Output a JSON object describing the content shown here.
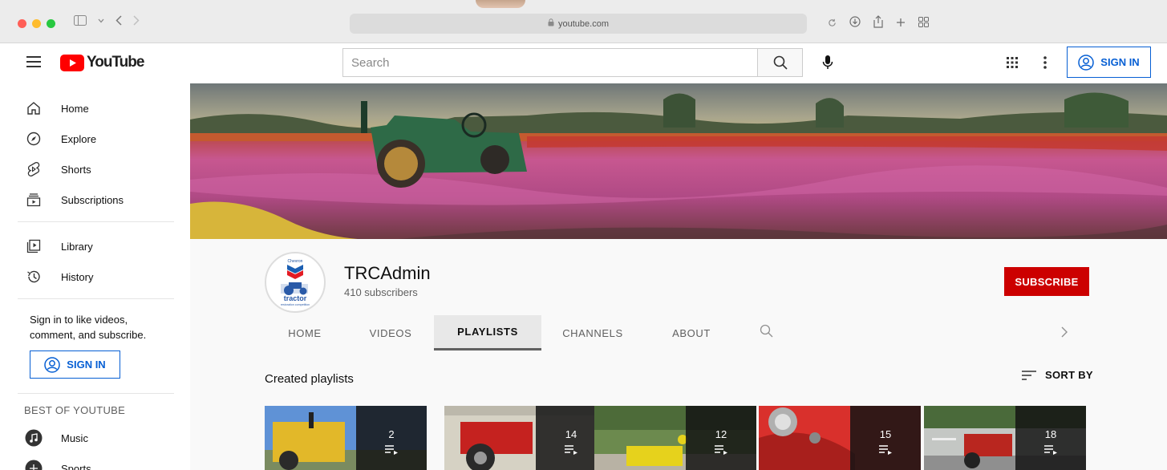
{
  "browser": {
    "url": "youtube.com"
  },
  "masthead": {
    "logo_text": "YouTube",
    "search_placeholder": "Search",
    "sign_in_label": "SIGN IN"
  },
  "sidebar": {
    "items": [
      {
        "label": "Home",
        "icon": "home-icon"
      },
      {
        "label": "Explore",
        "icon": "compass-icon"
      },
      {
        "label": "Shorts",
        "icon": "shorts-icon"
      },
      {
        "label": "Subscriptions",
        "icon": "subscriptions-icon"
      },
      {
        "label": "Library",
        "icon": "library-icon"
      },
      {
        "label": "History",
        "icon": "history-icon"
      }
    ],
    "signin_prompt": "Sign in to like videos, comment, and subscribe.",
    "sign_in_label": "SIGN IN",
    "best_title": "BEST OF YOUTUBE",
    "best_items": [
      {
        "label": "Music",
        "icon": "music-icon"
      },
      {
        "label": "Sports",
        "icon": "sports-icon"
      }
    ]
  },
  "channel": {
    "name": "TRCAdmin",
    "subscribers": "410 subscribers",
    "subscribe_label": "SUBSCRIBE",
    "avatar_text_top": "Chevron",
    "avatar_text": "tractor",
    "avatar_text_sub": "restoration competition",
    "tabs": [
      {
        "label": "HOME",
        "active": false
      },
      {
        "label": "VIDEOS",
        "active": false
      },
      {
        "label": "PLAYLISTS",
        "active": true
      },
      {
        "label": "CHANNELS",
        "active": false
      },
      {
        "label": "ABOUT",
        "active": false
      }
    ]
  },
  "playlists": {
    "section_title": "Created playlists",
    "sort_label": "SORT BY",
    "items": [
      {
        "count": "2",
        "thumb_color": "#e2b829"
      },
      {
        "count": "14",
        "thumb_color": "#c5221f"
      },
      {
        "count": "12",
        "thumb_color": "#e6d21c"
      },
      {
        "count": "15",
        "thumb_color": "#d9302c"
      },
      {
        "count": "18",
        "thumb_color": "#b9261f"
      }
    ]
  },
  "colors": {
    "accent_blue": "#065fd4",
    "subscribe_red": "#cc0000",
    "logo_red": "#ff0000"
  }
}
